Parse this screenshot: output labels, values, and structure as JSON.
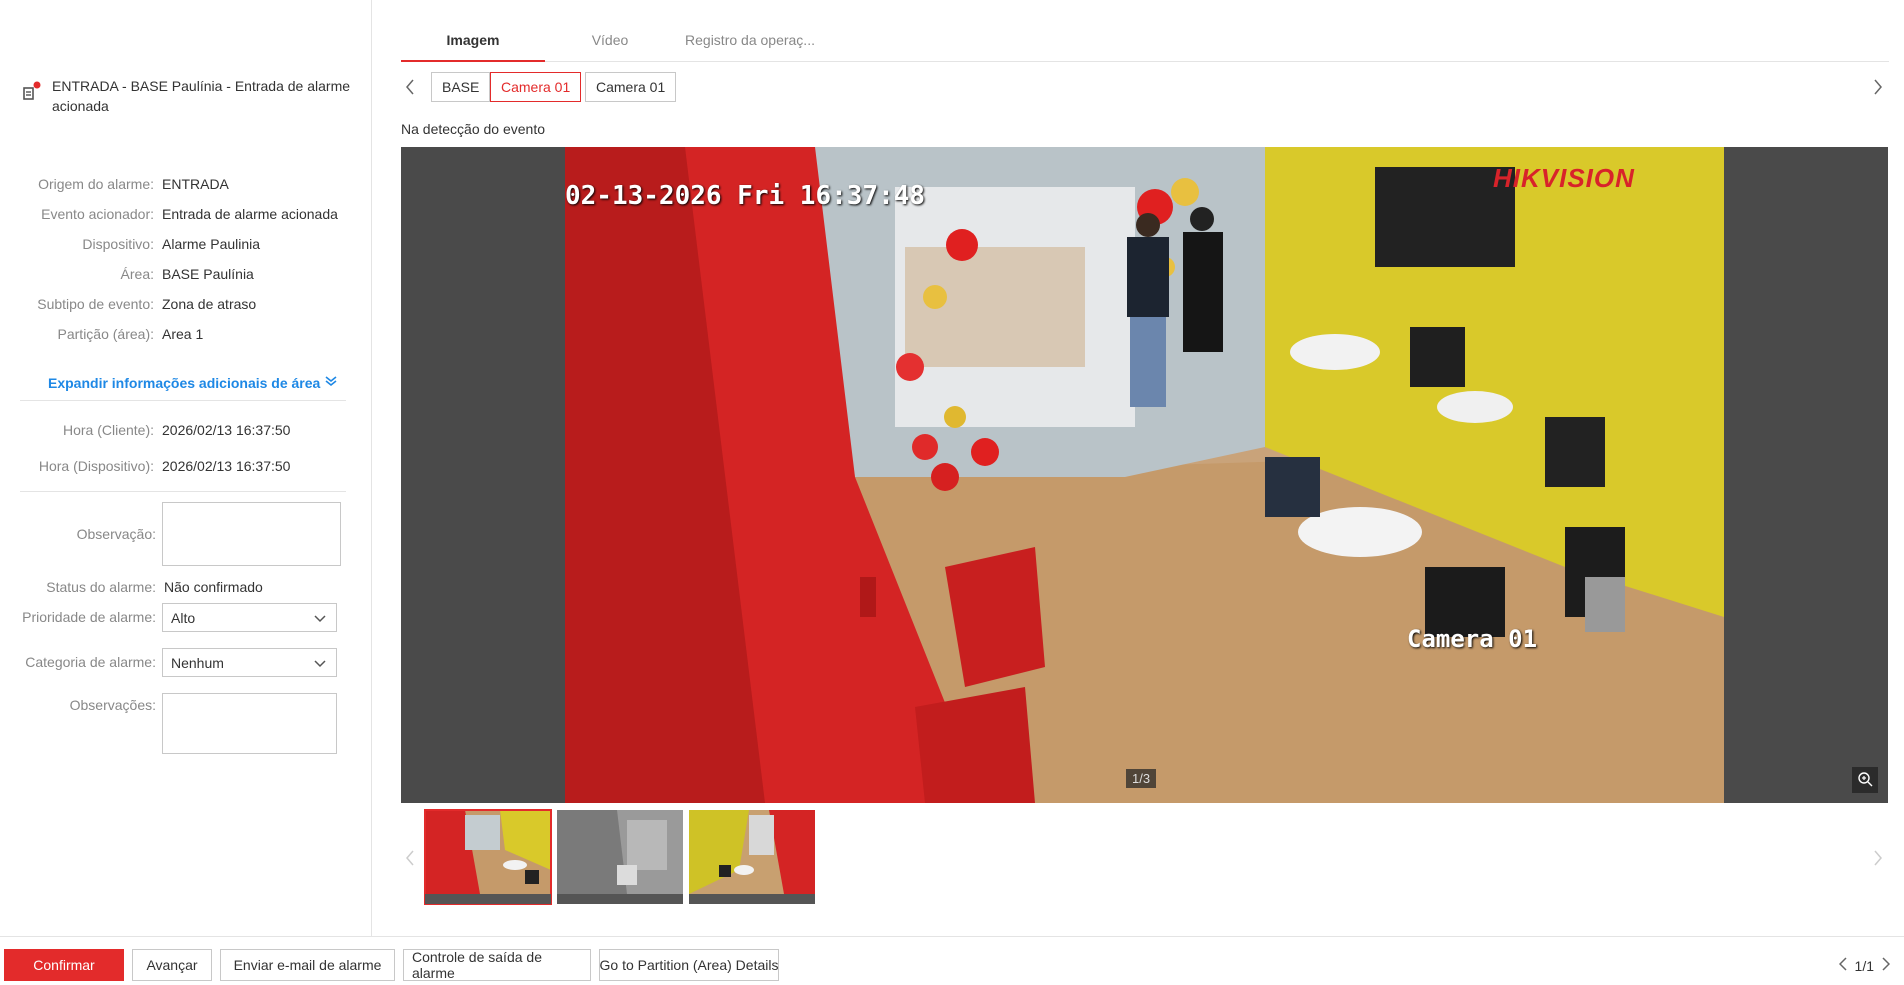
{
  "alarm": {
    "title": "ENTRADA - BASE Paulínia - Entrada de alarme acionada"
  },
  "details": [
    {
      "label": "Origem do alarme:",
      "value": "ENTRADA"
    },
    {
      "label": "Evento acionador:",
      "value": "Entrada de alarme acionada"
    },
    {
      "label": "Dispositivo:",
      "value": "Alarme Paulinia"
    },
    {
      "label": "Área:",
      "value": "BASE Paulínia"
    },
    {
      "label": "Subtipo de evento:",
      "value": "Zona de atraso"
    },
    {
      "label": "Partição (área):",
      "value": "Area 1"
    }
  ],
  "expand_label": "Expandir informações adicionais de área",
  "times": [
    {
      "label": "Hora (Cliente):",
      "value": "2026/02/13 16:37:50"
    },
    {
      "label": "Hora (Dispositivo):",
      "value": "2026/02/13 16:37:50"
    }
  ],
  "form": {
    "observation_label": "Observação:",
    "observation_value": "",
    "status_label": "Status do alarme:",
    "status_value": "Não confirmado",
    "priority_label": "Prioridade de alarme:",
    "priority_value": "Alto",
    "category_label": "Categoria de alarme:",
    "category_value": "Nenhum",
    "remarks_label": "Observações:",
    "remarks_value": ""
  },
  "tabs": [
    "Imagem",
    "Vídeo",
    "Registro da operaç..."
  ],
  "cameras": [
    "BASE",
    "Camera 01",
    "Camera 01"
  ],
  "event_label": "Na detecção do evento",
  "viewer": {
    "osd_time": "02-13-2026 Fri 16:37:48",
    "osd_camera": "Camera 01",
    "brand": "HIKVISION",
    "counter": "1/3"
  },
  "buttons": {
    "confirm": "Confirmar",
    "next": "Avançar",
    "email": "Enviar e-mail de alarme",
    "output": "Controle de saída de alarme",
    "partition": "Go to Partition (Area) Details"
  },
  "pager": "1/1",
  "colors": {
    "accent": "#e32b2b",
    "link": "#1e88e5"
  }
}
